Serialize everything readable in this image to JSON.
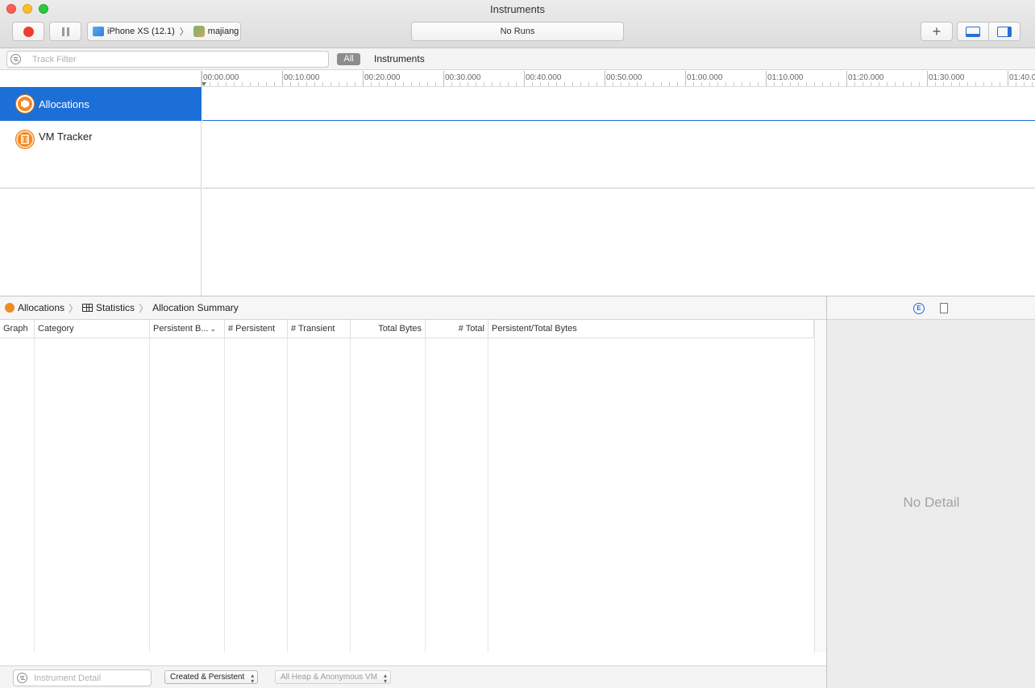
{
  "window": {
    "title": "Instruments"
  },
  "toolbar": {
    "device_label": "iPhone XS (12.1)",
    "app_label": "majiang",
    "runs_label": "No Runs",
    "add_label": "+"
  },
  "filter_bar": {
    "track_filter_placeholder": "Track Filter",
    "all_label": "All",
    "instruments_label": "Instruments"
  },
  "ruler": {
    "labels": [
      "00:00.000",
      "00:10.000",
      "00:20.000",
      "00:30.000",
      "00:40.000",
      "00:50.000",
      "01:00.000",
      "01:10.000",
      "01:20.000",
      "01:30.000",
      "01:40.0"
    ]
  },
  "tracks": [
    {
      "label": "Allocations",
      "selected": true
    },
    {
      "label": "VM Tracker",
      "selected": false
    }
  ],
  "detail": {
    "breadcrumb": [
      "Allocations",
      "Statistics",
      "Allocation Summary"
    ],
    "columns": [
      "Graph",
      "Category",
      "Persistent B...",
      "# Persistent",
      "# Transient",
      "Total Bytes",
      "# Total",
      "Persistent/Total Bytes"
    ],
    "instrument_detail_placeholder": "Instrument Detail",
    "lifespan_filter": "Created & Persistent",
    "allocation_type_filter": "All Heap & Anonymous VM"
  },
  "inspector": {
    "ext_icon_letter": "E",
    "empty_label": "No Detail"
  },
  "colors": {
    "selection": "#1d6fd8",
    "record": "#f03c2f",
    "instrument_orange": "#f08a24"
  }
}
